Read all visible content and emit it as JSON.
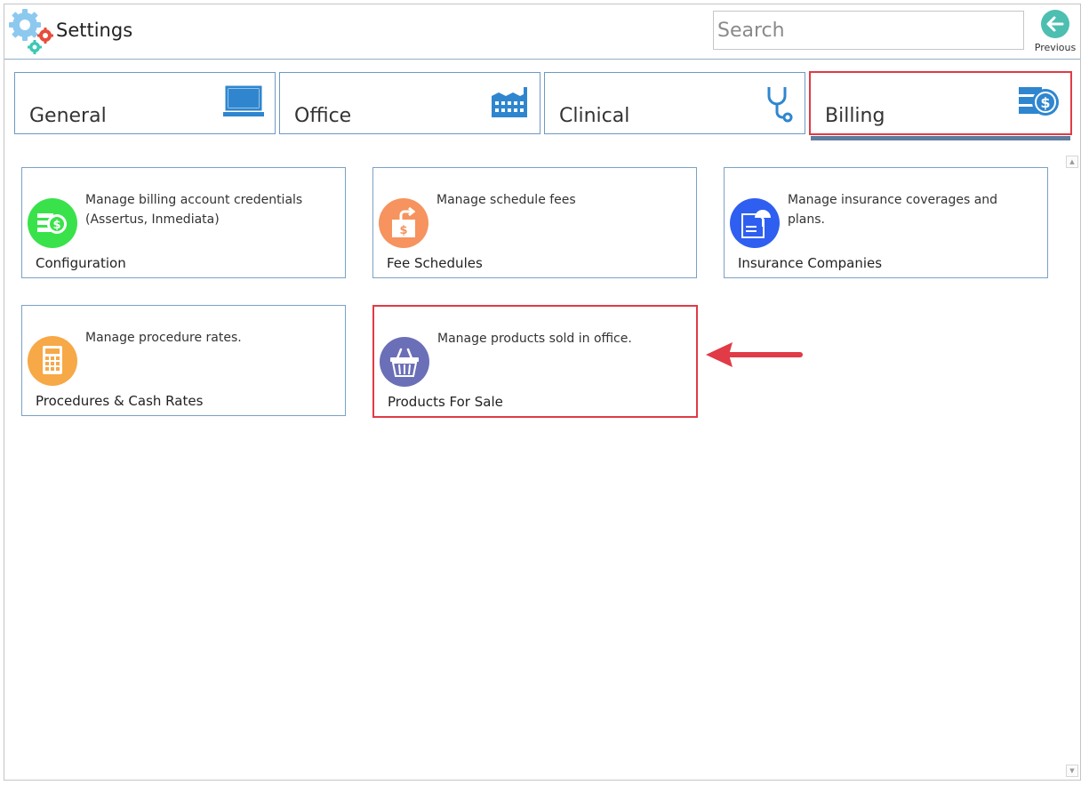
{
  "app": {
    "title": "Settings",
    "icon": "gears-icon"
  },
  "search": {
    "placeholder": "Search",
    "value": ""
  },
  "nav": {
    "previous_label": "Previous"
  },
  "tabs": [
    {
      "label": "General",
      "icon": "monitor-icon",
      "active": false
    },
    {
      "label": "Office",
      "icon": "factory-icon",
      "active": false
    },
    {
      "label": "Clinical",
      "icon": "stethoscope-icon",
      "active": false
    },
    {
      "label": "Billing",
      "icon": "billing-dollar-icon",
      "active": true
    }
  ],
  "cards": [
    {
      "title": "Configuration",
      "description": "Manage billing account credentials (Assertus, Inmediata)",
      "icon": "billing-config-icon",
      "icon_color": "#39e24a"
    },
    {
      "title": "Fee Schedules",
      "description": "Manage schedule fees",
      "icon": "fee-export-icon",
      "icon_color": "#f6935e"
    },
    {
      "title": "Insurance Companies",
      "description": "Manage insurance coverages and plans.",
      "icon": "insurance-document-icon",
      "icon_color": "#2f5ff0"
    },
    {
      "title": "Procedures & Cash Rates",
      "description": "Manage procedure rates.",
      "icon": "calculator-icon",
      "icon_color": "#f7a847"
    },
    {
      "title": "Products For Sale",
      "description": "Manage products sold in office.",
      "icon": "basket-icon",
      "icon_color": "#6b6fb7",
      "highlighted": true
    }
  ],
  "colors": {
    "accent": "#3c8ed0",
    "highlight": "#e03b46",
    "tab_border": "#6e99c4",
    "active_underline": "#5e7c9e"
  }
}
